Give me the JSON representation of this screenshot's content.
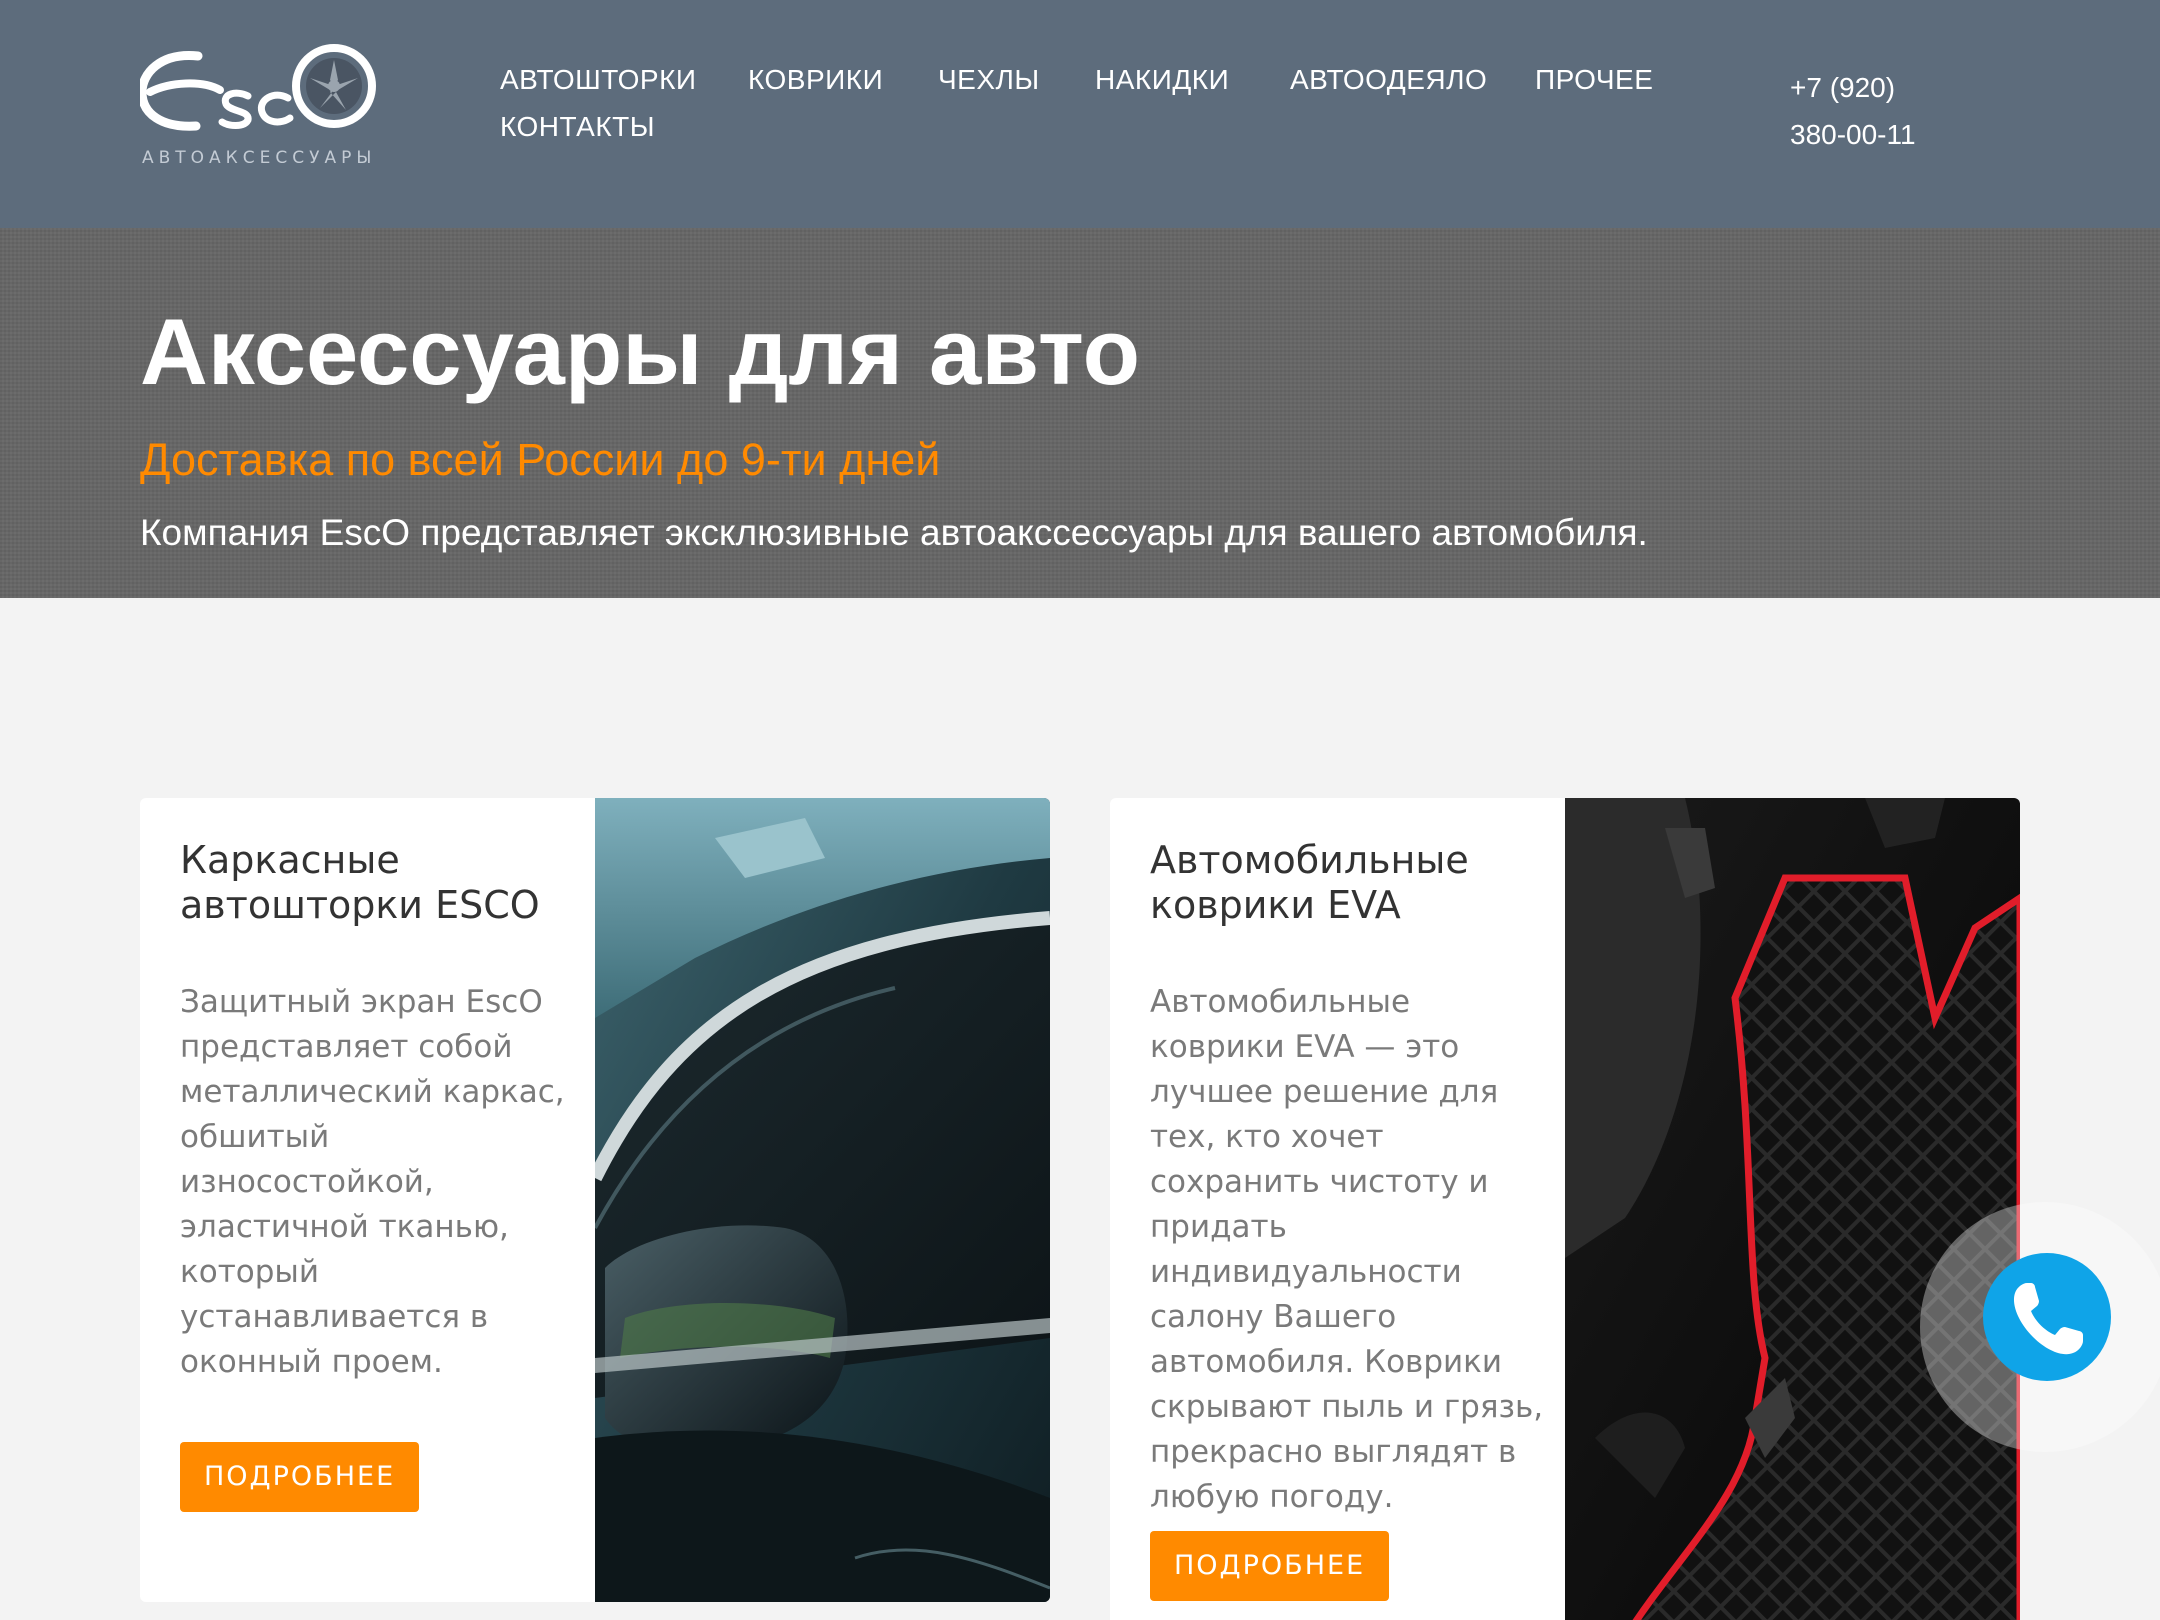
{
  "header": {
    "logo_text": "EscO",
    "logo_subtitle": "АВТОАКСЕССУАРЫ",
    "nav": [
      {
        "label": "АВТОШТОРКИ"
      },
      {
        "label": "КОВРИКИ"
      },
      {
        "label": "ЧЕХЛЫ"
      },
      {
        "label": "НАКИДКИ"
      },
      {
        "label": "АВТООДЕЯЛО"
      },
      {
        "label": "ПРОЧЕЕ"
      },
      {
        "label": "КОНТАКТЫ"
      }
    ],
    "phone_line1": "+7 (920)",
    "phone_line2": "380-00-11"
  },
  "hero": {
    "title": "Аксессуары для авто",
    "subtitle": "Доставка по всей России до 9-ти дней",
    "description": "Компания EscO представляет эксклюзивные автоакссессуары для вашего автомобиля."
  },
  "cards": [
    {
      "title": "Каркасные автошторки ESCO",
      "body": "Защитный экран EscO представляет собой металлический каркас, обшитый износостойкой, эластичной тканью, который устанавливается в оконный проем.",
      "button": "ПОДРОБНЕЕ"
    },
    {
      "title": "Автомобильные коврики EVA",
      "body": "Автомобильные коврики EVA — это лучшее решение для тех, кто хочет сохранить чистоту и придать индивидуальности салону Вашего автомобиля. Коврики скрывают пыль и грязь, прекрасно выглядят в любую погоду.",
      "button": "ПОДРОБНЕЕ"
    }
  ],
  "colors": {
    "header_bg": "#5d6c7c",
    "accent": "#ff8a00",
    "call_button": "#0fa4e8"
  },
  "icons": {
    "call": "phone-icon",
    "logo_wheel": "wheel-icon"
  }
}
